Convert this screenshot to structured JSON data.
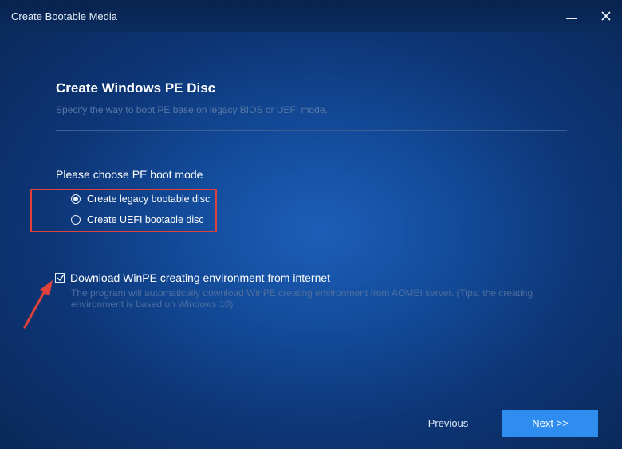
{
  "window": {
    "title": "Create Bootable Media"
  },
  "header": {
    "title": "Create Windows PE Disc",
    "subtitle": "Specify the way to boot PE base on legacy BIOS or UEFI mode."
  },
  "boot_mode": {
    "label": "Please choose PE boot mode",
    "options": [
      {
        "label": "Create legacy bootable disc",
        "selected": true
      },
      {
        "label": "Create UEFI bootable disc",
        "selected": false
      }
    ]
  },
  "download": {
    "label": "Download WinPE creating environment from internet",
    "checked": true,
    "description": "The program will automatically download WinPE creating environment from AOMEI server. (Tips: the creating environment is based on Windows 10)"
  },
  "footer": {
    "previous_label": "Previous",
    "next_label": "Next >>"
  },
  "colors": {
    "accent": "#2f8df0",
    "highlight": "#e0413a",
    "background": "#134a98"
  },
  "icons": {
    "minimize": "minimize-icon",
    "close": "close-icon",
    "arrow": "annotation-arrow-icon"
  }
}
